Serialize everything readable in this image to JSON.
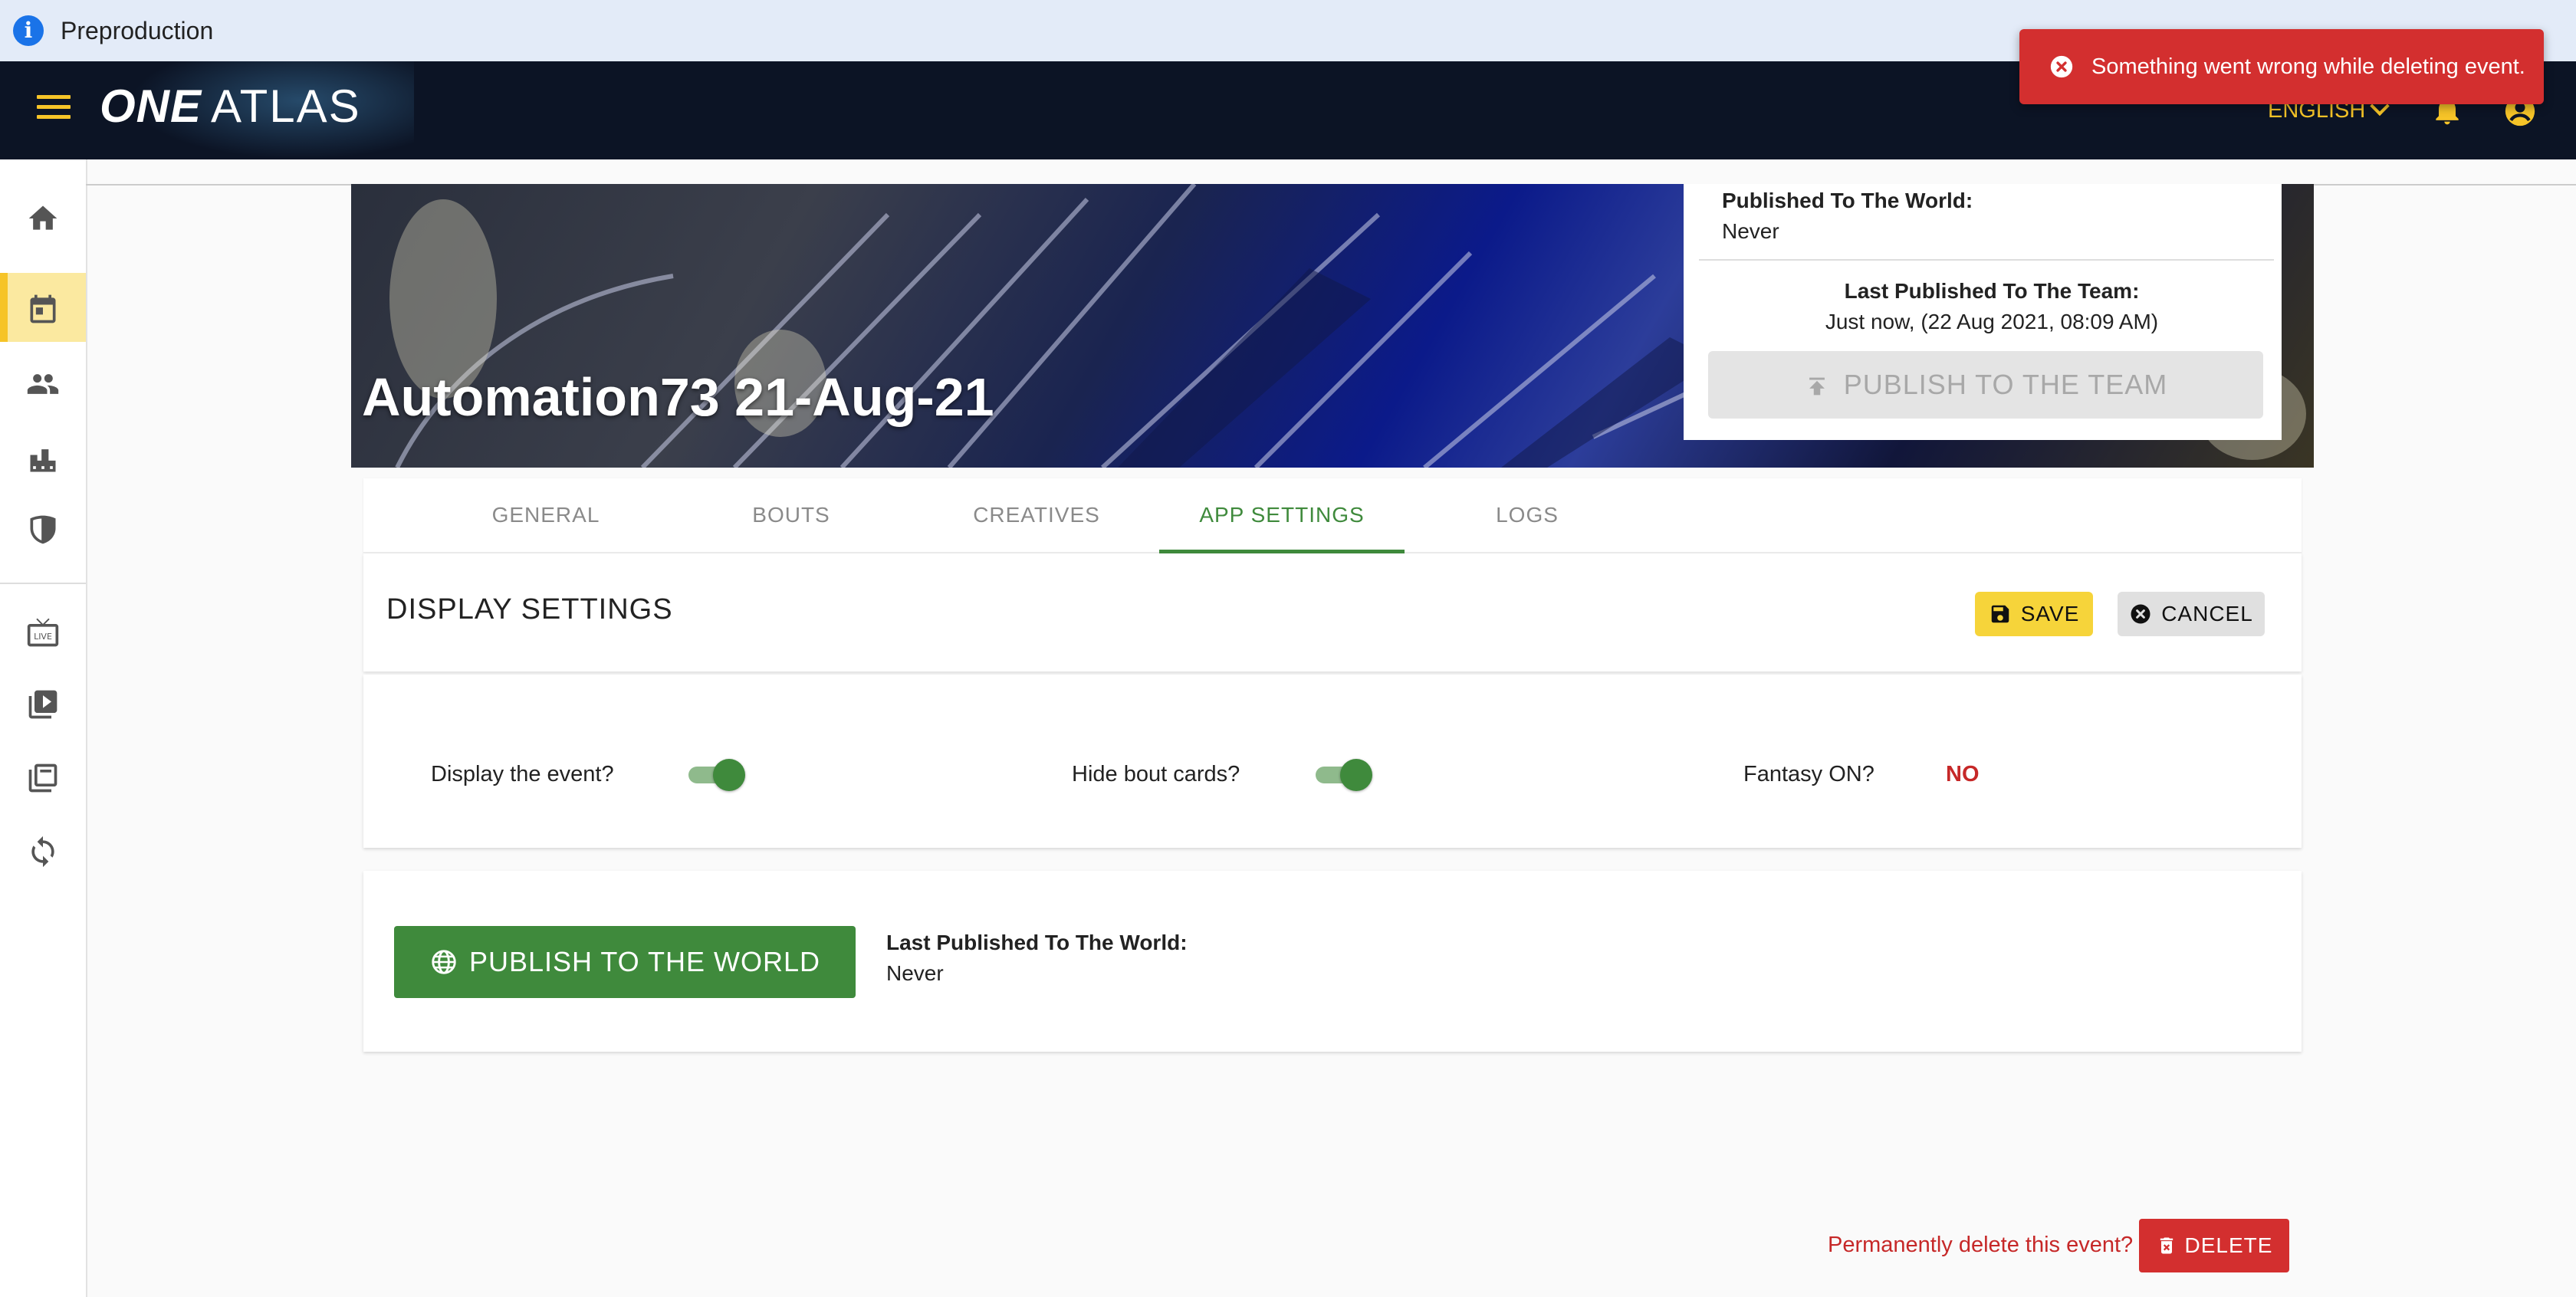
{
  "environment": {
    "label": "Preproduction",
    "icon": "info-icon"
  },
  "appbar": {
    "logo_one": "ONE",
    "logo_atlas": "ATLAS",
    "language": "ENGLISH",
    "icons": [
      "menu-icon",
      "chevron-down-icon",
      "bell-icon",
      "account-icon"
    ],
    "accent": "#f6c428",
    "background": "#0c1425"
  },
  "toast": {
    "message": "Something went wrong while deleting event.",
    "icon": "error-circle-icon",
    "color": "#d32f2f"
  },
  "sidebar": {
    "items": [
      {
        "icon": "home-icon",
        "active": false
      },
      {
        "icon": "calendar-icon",
        "active": true
      },
      {
        "icon": "people-icon",
        "active": false
      },
      {
        "icon": "building-icon",
        "active": false
      },
      {
        "icon": "shield-icon",
        "active": false
      },
      {
        "icon": "live-tv-icon",
        "active": false
      },
      {
        "icon": "video-library-icon",
        "active": false
      },
      {
        "icon": "collections-icon",
        "active": false
      },
      {
        "icon": "sync-icon",
        "active": false
      }
    ]
  },
  "event": {
    "title": "Automation73 21-Aug-21",
    "published_world_label": "Published To The World:",
    "published_world_value": "Never",
    "published_team_label": "Last Published To The Team:",
    "published_team_value": "Just now, (22 Aug 2021, 08:09 AM)",
    "publish_team_button": "PUBLISH TO THE TEAM"
  },
  "tabs": [
    {
      "label": "GENERAL",
      "active": false
    },
    {
      "label": "BOUTS",
      "active": false
    },
    {
      "label": "CREATIVES",
      "active": false
    },
    {
      "label": "APP SETTINGS",
      "active": true
    },
    {
      "label": "LOGS",
      "active": false
    }
  ],
  "display_settings": {
    "title": "DISPLAY SETTINGS",
    "save_label": "SAVE",
    "cancel_label": "CANCEL",
    "display_event_label": "Display the event?",
    "display_event_on": true,
    "hide_bout_cards_label": "Hide bout cards?",
    "hide_bout_cards_on": true,
    "fantasy_label": "Fantasy ON?",
    "fantasy_value": "NO"
  },
  "publish_world": {
    "button_label": "PUBLISH TO THE WORLD",
    "last_label": "Last Published To The World:",
    "last_value": "Never",
    "color": "#3f8a3c"
  },
  "delete": {
    "prompt": "Permanently delete this event?",
    "button_label": "DELETE"
  }
}
